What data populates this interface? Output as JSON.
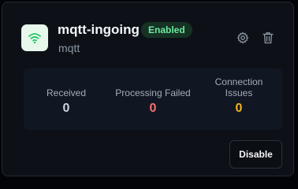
{
  "connector": {
    "name": "mqtt-ingoing",
    "type": "mqtt",
    "status": "Enabled",
    "icon": "wifi-signal-icon"
  },
  "actions": {
    "settings_icon": "gear-icon",
    "delete_icon": "trash-icon",
    "disable_label": "Disable"
  },
  "stats": {
    "received": {
      "label": "Received",
      "value": "0"
    },
    "processing_failed": {
      "label": "Processing Failed",
      "value": "0"
    },
    "connection_issues": {
      "label_line1": "Connection",
      "label_line2": "Issues",
      "value": "0"
    }
  },
  "colors": {
    "accent_green": "#22c55e",
    "badge_text": "#6ee7a0",
    "received_value": "#cbd5e1",
    "failed_value": "#f87171",
    "issues_value": "#f5b320"
  }
}
